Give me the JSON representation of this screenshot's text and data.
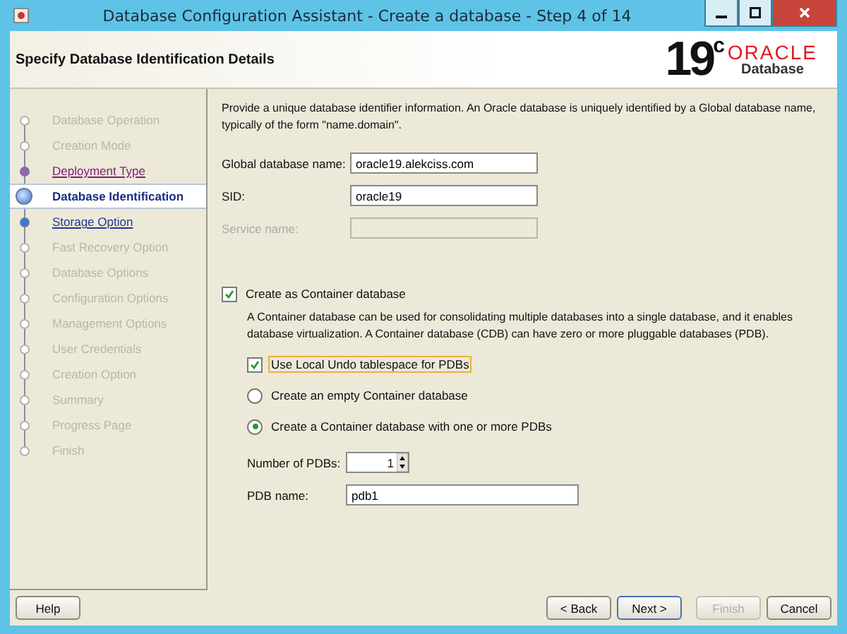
{
  "window": {
    "title": "Database Configuration Assistant - Create a database - Step 4 of 14"
  },
  "header": {
    "title": "Specify Database Identification Details",
    "logo_version": "19",
    "logo_sup": "c",
    "logo_brand": "ORACLE",
    "logo_product": "Database"
  },
  "steps": [
    {
      "label": "Database Operation",
      "selected": false,
      "visited": false,
      "disabled": true
    },
    {
      "label": "Creation Mode",
      "selected": false,
      "visited": false,
      "disabled": true
    },
    {
      "label": "Deployment Type",
      "selected": false,
      "visited": true,
      "disabled": false
    },
    {
      "label": "Database Identification",
      "selected": true,
      "visited": false,
      "disabled": false
    },
    {
      "label": "Storage Option",
      "selected": false,
      "visited": false,
      "disabled": false
    },
    {
      "label": "Fast Recovery Option",
      "selected": false,
      "visited": false,
      "disabled": true
    },
    {
      "label": "Database Options",
      "selected": false,
      "visited": false,
      "disabled": true
    },
    {
      "label": "Configuration Options",
      "selected": false,
      "visited": false,
      "disabled": true
    },
    {
      "label": "Management Options",
      "selected": false,
      "visited": false,
      "disabled": true
    },
    {
      "label": "User Credentials",
      "selected": false,
      "visited": false,
      "disabled": true
    },
    {
      "label": "Creation Option",
      "selected": false,
      "visited": false,
      "disabled": true
    },
    {
      "label": "Summary",
      "selected": false,
      "visited": false,
      "disabled": true
    },
    {
      "label": "Progress Page",
      "selected": false,
      "visited": false,
      "disabled": true
    },
    {
      "label": "Finish",
      "selected": false,
      "visited": false,
      "disabled": true
    }
  ],
  "intro": "Provide a unique database identifier information. An Oracle database is uniquely identified by a Global database name, typically of the form \"name.domain\".",
  "fields": [
    {
      "label": "Global database name:",
      "value": "oracle19.alekciss.com",
      "disabled": false
    },
    {
      "label": "SID:",
      "value": "oracle19",
      "disabled": false
    },
    {
      "label": "Service name:",
      "disabled": true
    }
  ],
  "container": {
    "label": "Create as Container database",
    "checked": true,
    "description": "A Container database can be used for consolidating multiple databases into a single database, and it enables database virtualization. A Container database (CDB) can have zero or more pluggable databases (PDB).",
    "options": [
      {
        "kind": "checkbox",
        "label": "Use Local Undo tablespace for PDBs",
        "checked": true,
        "focused": true
      },
      {
        "kind": "radio",
        "label": "Create an empty Container database",
        "selected": false
      },
      {
        "kind": "radio",
        "label": "Create a Container database with one or more PDBs",
        "selected": true
      }
    ],
    "pdb_count": {
      "label": "Number of PDBs:",
      "value": "1"
    },
    "pdb_name": {
      "label": "PDB name:",
      "value": "pdb1"
    }
  },
  "buttons": [
    {
      "label": "Help",
      "disabled": false,
      "default": false
    },
    {
      "label": "< Back",
      "disabled": false,
      "default": false
    },
    {
      "label": "Next >",
      "disabled": false,
      "default": true
    },
    {
      "label": "Finish",
      "disabled": true,
      "default": false
    },
    {
      "label": "Cancel",
      "disabled": false,
      "default": false
    }
  ]
}
